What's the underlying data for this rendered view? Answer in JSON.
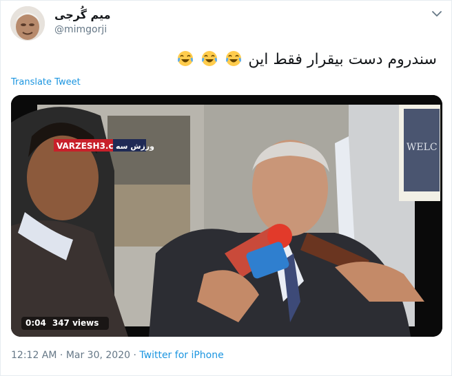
{
  "user": {
    "display_name": "میم گُرجی",
    "handle": "@mimgorji",
    "avatar": "avatar-photo"
  },
  "tweet": {
    "text": "سندروم دست بیقرار فقط این",
    "emoji": [
      "face-with-tears-of-joy",
      "face-with-tears-of-joy",
      "face-with-tears-of-joy"
    ],
    "translate_label": "Translate Tweet"
  },
  "video": {
    "duration": "0:04",
    "views": "347 views",
    "watermark_latin": "VARZESH3.com",
    "watermark_persian": "ورزش سه",
    "background_sign": "WELC"
  },
  "meta": {
    "time": "12:12 AM",
    "separator": "·",
    "date": "Mar 30, 2020",
    "source": "Twitter for iPhone"
  },
  "colors": {
    "link": "#1b95e0",
    "secondary_text": "#657786",
    "primary_text": "#14171a",
    "border": "#e6ecf0"
  }
}
